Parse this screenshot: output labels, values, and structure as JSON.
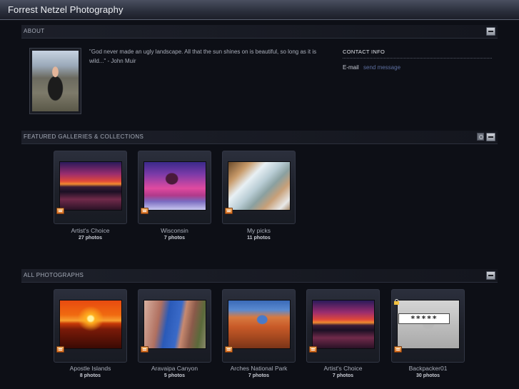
{
  "header": {
    "site_title": "Forrest Netzel Photography"
  },
  "about": {
    "section_label": "ABOUT",
    "quote": "\"God never made an ugly landscape. All that the sun shines on is beautiful, so long as it is wild...\" - John Muir",
    "contact_title": "CONTACT INFO",
    "email_label": "E-mail",
    "email_link": "send message"
  },
  "featured": {
    "section_label": "FEATURED GALLERIES & COLLECTIONS",
    "items": [
      {
        "title": "Artist's Choice",
        "count": "27 photos",
        "image": "sunset-lake"
      },
      {
        "title": "Wisconsin",
        "count": "7 photos",
        "image": "purple-tree"
      },
      {
        "title": "My picks",
        "count": "11 photos",
        "image": "waterfall"
      }
    ]
  },
  "all_photos": {
    "section_label": "ALL PHOTOGRAPHS",
    "items": [
      {
        "title": "Apostle Islands",
        "count": "8 photos",
        "image": "orange-sunset"
      },
      {
        "title": "Aravaipa Canyon",
        "count": "5 photos",
        "image": "canyon"
      },
      {
        "title": "Arches National Park",
        "count": "7 photos",
        "image": "arch"
      },
      {
        "title": "Artist's Choice",
        "count": "7 photos",
        "image": "sunset-lake"
      },
      {
        "title": "Backpacker01",
        "count": "30 photos",
        "image": "locked",
        "password_mask": "*****"
      }
    ]
  },
  "icons": {
    "collapse": "minus-icon",
    "rss": "feed-icon",
    "gallery_badge": "gallery-icon",
    "lock": "lock-icon"
  }
}
